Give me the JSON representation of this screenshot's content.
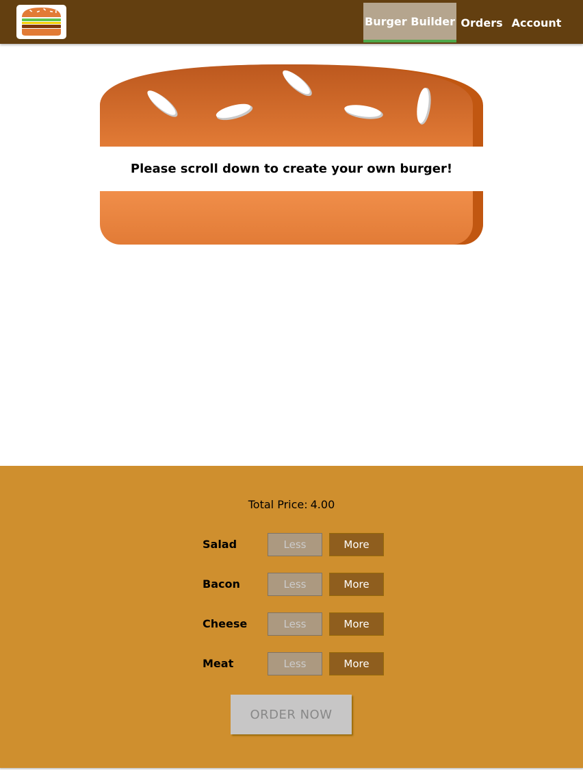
{
  "toolbar": {
    "logo_icon": "burger-logo-icon",
    "nav": {
      "builder": "Burger Builder",
      "orders": "Orders",
      "account": "Account"
    },
    "active_item": "Burger Builder",
    "colors": {
      "toolbar_bg": "#633f10",
      "active_bg": "#b5a58e",
      "active_underline": "#4ea84a"
    }
  },
  "burger": {
    "message": "Please scroll down to create your own burger!",
    "colors": {
      "bun": "#e27b36",
      "bun_shadow": "#c15711",
      "seeds": "#ffffff"
    }
  },
  "build_controls": {
    "price_label": "Total Price:",
    "price_value": "4.00",
    "less_label": "Less",
    "more_label": "More",
    "ingredients": [
      {
        "label": "Salad"
      },
      {
        "label": "Bacon"
      },
      {
        "label": "Cheese"
      },
      {
        "label": "Meat"
      }
    ],
    "order_button": "ORDER NOW",
    "colors": {
      "panel_bg": "#cf8f2e",
      "more_bg": "#8f5e1e",
      "less_bg": "#ac9980",
      "order_disabled_bg": "#c7c6c6"
    }
  }
}
